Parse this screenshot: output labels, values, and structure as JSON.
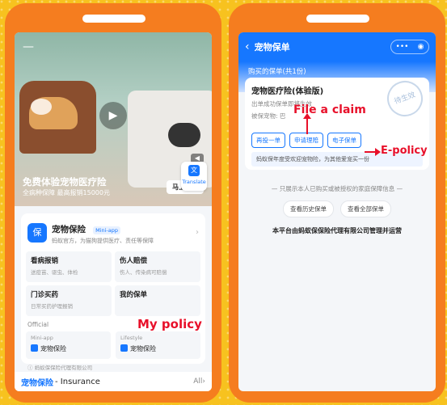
{
  "left": {
    "hero": {
      "title": "免费体验宠物医疗险",
      "subtitle": "全病种保障 最高报销15000元",
      "claim_button": "马上领取"
    },
    "app": {
      "name": "宠物保险",
      "tag": "Mini-app",
      "desc": "蚂蚁官方，为猫狗提供医疗、责任等保障"
    },
    "tiles": [
      {
        "title": "看病报销",
        "desc": "送疫苗、驱虫、体检"
      },
      {
        "title": "伤人赔偿",
        "desc": "伤人、传染病可赔偿"
      },
      {
        "title": "门诊买药",
        "desc": "日常买药护理报销"
      },
      {
        "title": "我的保单",
        "desc": ""
      }
    ],
    "official_label": "Official",
    "official": [
      {
        "label": "Mini-app",
        "name": "宠物保险"
      },
      {
        "label": "Lifestyle",
        "name": "宠物保险"
      }
    ],
    "agency": "蚂蚁保保险代理有限公司",
    "translate": "Translate",
    "bottom": {
      "title": "宠物保险",
      "subtitle": "- Insurance",
      "all": "All"
    },
    "annotation": "My policy"
  },
  "right": {
    "nav": {
      "title": "宠物保单",
      "more": "•••",
      "target": "◉"
    },
    "count": "购买的保单(共1份)",
    "policy": {
      "title": "宠物医疗险(体验版)",
      "line1": "出单成功保单即将生效",
      "line2": "被保宠物: 巴",
      "stamp": "待生效"
    },
    "buttons": [
      "再投一单",
      "申请理赔",
      "电子保单"
    ],
    "tip": "蚂蚁保年度受欢迎宠物险，为其他爱宠买一份",
    "divider": "只展示本人已购买或被授权的家庭保障信息",
    "history_buttons": [
      "查看历史保单",
      "查看全部保单"
    ],
    "footer": "本平台由蚂蚁保保险代理有限公司管理并运营",
    "annotations": {
      "file_claim": "File a claim",
      "e_policy": "E-policy"
    }
  },
  "colors": {
    "background": "#f7c21f",
    "phone": "#f57d1f",
    "accent": "#1677ff",
    "annotation": "#e8102a"
  }
}
